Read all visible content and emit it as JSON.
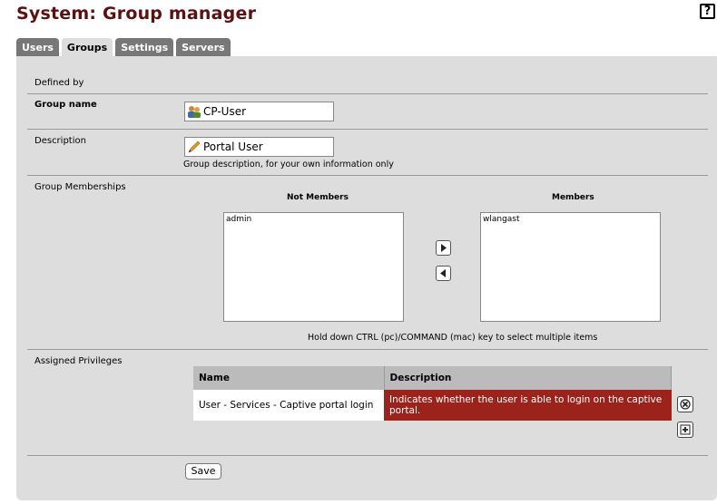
{
  "header": {
    "title": "System: Group manager",
    "help_icon": "help-icon",
    "help_glyph": "?"
  },
  "tabs": [
    {
      "label": "Users",
      "active": false
    },
    {
      "label": "Groups",
      "active": true
    },
    {
      "label": "Settings",
      "active": false
    },
    {
      "label": "Servers",
      "active": false
    }
  ],
  "form": {
    "defined_by_label": "Defined by",
    "group_name_label": "Group name",
    "group_name_value": "CP-User",
    "group_name_icon": "users-icon",
    "description_label": "Description",
    "description_value": "Portal User",
    "description_icon": "pencil-icon",
    "description_hint": "Group description, for your own information only",
    "memberships_label": "Group Memberships",
    "not_members_header": "Not Members",
    "members_header": "Members",
    "not_members": [
      "admin"
    ],
    "members": [
      "wlangast"
    ],
    "multi_select_hint": "Hold down CTRL (pc)/COMMAND (mac) key to select multiple items",
    "privileges_label": "Assigned Privileges",
    "privileges_table": {
      "columns": [
        "Name",
        "Description"
      ],
      "rows": [
        {
          "name": "User - Services - Captive portal login",
          "description": "Indicates whether the user is able to login on the captive portal."
        }
      ]
    },
    "save_label": "Save"
  },
  "colors": {
    "title": "#5c1010",
    "panel": "#dddddd",
    "tab_inactive": "#777777",
    "desc_highlight": "#9c221c"
  }
}
